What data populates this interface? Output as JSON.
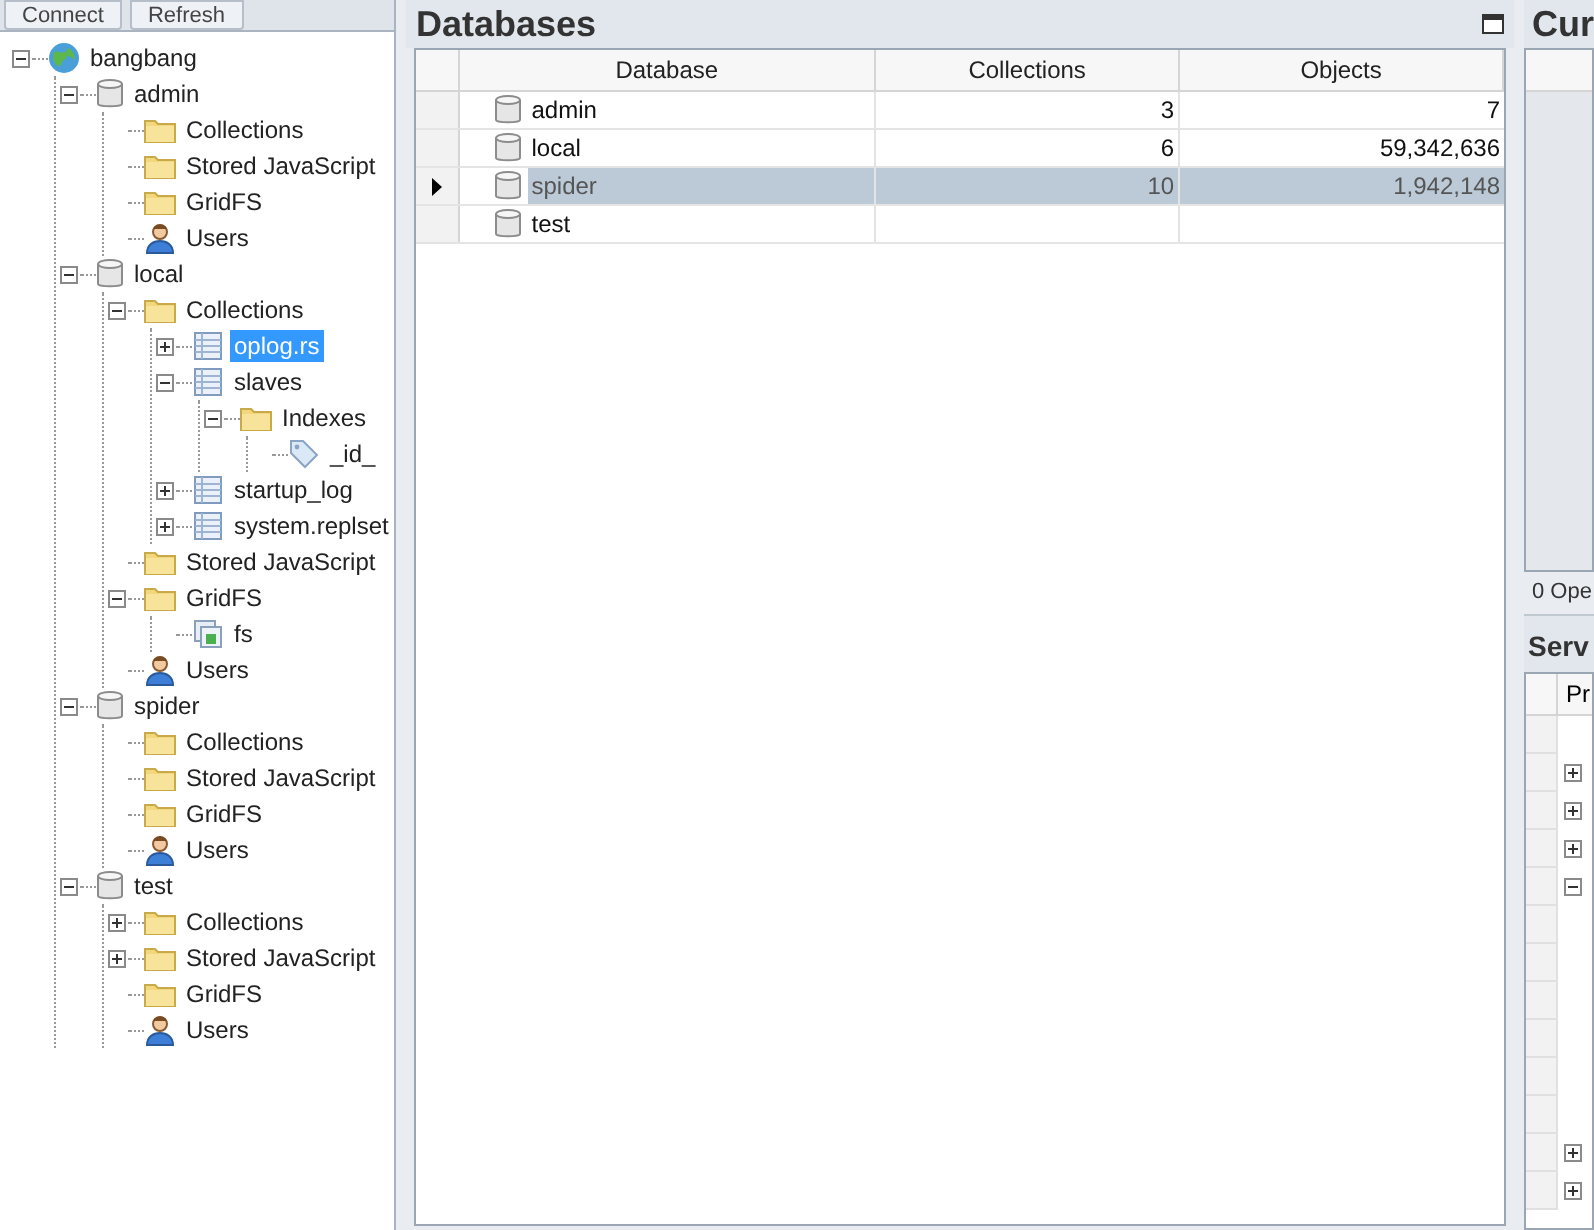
{
  "toolbar": {
    "buttons": [
      "Connect",
      "Refresh"
    ]
  },
  "tree": [
    {
      "kind": "server",
      "label": "bangbang",
      "expanded": true,
      "selected": false,
      "children": [
        {
          "kind": "database",
          "label": "admin",
          "expanded": true,
          "selected": false,
          "children": [
            {
              "kind": "folder",
              "label": "Collections",
              "selected": false
            },
            {
              "kind": "folder",
              "label": "Stored JavaScript",
              "selected": false
            },
            {
              "kind": "folder",
              "label": "GridFS",
              "selected": false
            },
            {
              "kind": "users",
              "label": "Users",
              "selected": false
            }
          ]
        },
        {
          "kind": "database",
          "label": "local",
          "expanded": true,
          "selected": false,
          "children": [
            {
              "kind": "folder",
              "label": "Collections",
              "expanded": true,
              "selected": false,
              "children": [
                {
                  "kind": "collection",
                  "label": "oplog.rs",
                  "expanded": false,
                  "selected": true
                },
                {
                  "kind": "collection",
                  "label": "slaves",
                  "expanded": true,
                  "selected": false,
                  "children": [
                    {
                      "kind": "folder",
                      "label": "Indexes",
                      "expanded": true,
                      "selected": false,
                      "children": [
                        {
                          "kind": "index",
                          "label": "_id_",
                          "selected": false
                        }
                      ]
                    }
                  ]
                },
                {
                  "kind": "collection",
                  "label": "startup_log",
                  "expanded": false,
                  "selected": false
                },
                {
                  "kind": "collection",
                  "label": "system.replset",
                  "expanded": false,
                  "selected": false
                }
              ]
            },
            {
              "kind": "folder",
              "label": "Stored JavaScript",
              "selected": false
            },
            {
              "kind": "folder",
              "label": "GridFS",
              "expanded": true,
              "selected": false,
              "children": [
                {
                  "kind": "bucket",
                  "label": "fs",
                  "selected": false
                }
              ]
            },
            {
              "kind": "users",
              "label": "Users",
              "selected": false
            }
          ]
        },
        {
          "kind": "database",
          "label": "spider",
          "expanded": true,
          "selected": false,
          "children": [
            {
              "kind": "folder",
              "label": "Collections",
              "selected": false
            },
            {
              "kind": "folder",
              "label": "Stored JavaScript",
              "selected": false
            },
            {
              "kind": "folder",
              "label": "GridFS",
              "selected": false
            },
            {
              "kind": "users",
              "label": "Users",
              "selected": false
            }
          ]
        },
        {
          "kind": "database",
          "label": "test",
          "expanded": true,
          "selected": false,
          "children": [
            {
              "kind": "folder",
              "label": "Collections",
              "expanded": false,
              "selected": false
            },
            {
              "kind": "folder",
              "label": "Stored JavaScript",
              "expanded": false,
              "selected": false
            },
            {
              "kind": "folder",
              "label": "GridFS",
              "selected": false
            },
            {
              "kind": "users",
              "label": "Users",
              "selected": false
            }
          ]
        }
      ]
    }
  ],
  "databases": {
    "title": "Databases",
    "columns": [
      "Database",
      "Collections",
      "Objects"
    ],
    "rows": [
      {
        "name": "admin",
        "collections": "3",
        "objects": "7",
        "selected": false
      },
      {
        "name": "local",
        "collections": "6",
        "objects": "59,342,636",
        "selected": false
      },
      {
        "name": "spider",
        "collections": "10",
        "objects": "1,942,148",
        "selected": true
      },
      {
        "name": "test",
        "selected": false
      }
    ]
  },
  "right": {
    "title": "Cur",
    "status": "0 Ope",
    "server_title": "Serv",
    "column": "Pr",
    "rows": [
      {
        "kind": "blank"
      },
      {
        "kind": "node",
        "expanded": false
      },
      {
        "kind": "node",
        "expanded": false
      },
      {
        "kind": "node",
        "expanded": false
      },
      {
        "kind": "node",
        "expanded": true
      },
      {
        "kind": "blank"
      },
      {
        "kind": "blank"
      },
      {
        "kind": "blank"
      },
      {
        "kind": "blank"
      },
      {
        "kind": "blank"
      },
      {
        "kind": "blank"
      },
      {
        "kind": "node",
        "expanded": false
      },
      {
        "kind": "node",
        "expanded": false
      }
    ]
  }
}
